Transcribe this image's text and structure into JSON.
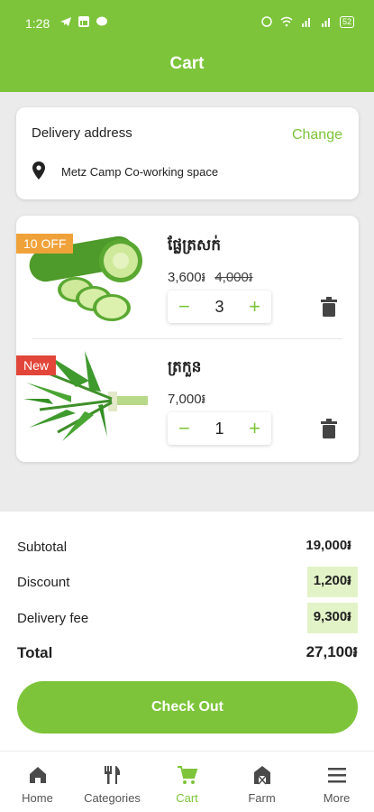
{
  "status_bar": {
    "time": "1:28",
    "battery": "52"
  },
  "header": {
    "title": "Cart"
  },
  "address": {
    "label": "Delivery address",
    "change_label": "Change",
    "location": "Metz Camp Co-working space",
    "icon": "location-pin-icon"
  },
  "items": [
    {
      "badge": "10 OFF",
      "name": "ផ្លែត្រសក់",
      "price": "3,600៛",
      "old_price": "4,000៛",
      "quantity": "3"
    },
    {
      "badge": "New",
      "name": "ត្រកួន",
      "price": "7,000៛",
      "old_price": "",
      "quantity": "1"
    }
  ],
  "stepper": {
    "minus": "−",
    "plus": "+"
  },
  "summary": {
    "subtotal_label": "Subtotal",
    "subtotal": "19,000៛",
    "discount_label": "Discount",
    "discount": "1,200៛",
    "fee_label": "Delivery fee",
    "fee": "9,300៛",
    "total_label": "Total",
    "total": "27,100៛"
  },
  "checkout_label": "Check Out",
  "nav": [
    {
      "label": "Home",
      "icon": "home-icon"
    },
    {
      "label": "Categories",
      "icon": "categories-icon"
    },
    {
      "label": "Cart",
      "icon": "cart-icon"
    },
    {
      "label": "Farm",
      "icon": "farm-icon"
    },
    {
      "label": "More",
      "icon": "menu-icon"
    }
  ],
  "colors": {
    "brand": "#7dc43a",
    "badge_off": "#f0a23a",
    "badge_new": "#e2463a",
    "highlight": "#e3f3c8"
  }
}
